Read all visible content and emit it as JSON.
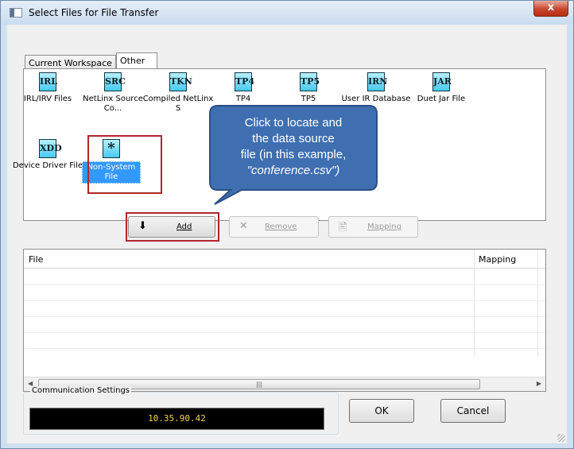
{
  "window": {
    "title": "Select Files for File Transfer",
    "close_glyph": "x"
  },
  "tabs": [
    {
      "label": "Current Workspace"
    },
    {
      "label": "Other"
    }
  ],
  "file_types": [
    {
      "glyph": "IRL",
      "label": "IRL/IRV Files"
    },
    {
      "glyph": "SRC",
      "label": "NetLinx Source Co..."
    },
    {
      "glyph": "TKN",
      "label": "Compiled NetLinx S"
    },
    {
      "glyph": "TP4",
      "label": "TP4"
    },
    {
      "glyph": "TP5",
      "label": "TP5"
    },
    {
      "glyph": "IRN",
      "label": "User IR Database"
    },
    {
      "glyph": "JAR",
      "label": "Duet Jar File"
    },
    {
      "glyph": "XDD",
      "label": "Device Driver File"
    },
    {
      "glyph": "*",
      "label": "Non-System File"
    }
  ],
  "callout": {
    "line1": "Click to locate and",
    "line2": "the data source",
    "line3": "file (in this example,",
    "line4": "\"conference.csv\")"
  },
  "buttons": {
    "add": "Add",
    "remove": "Remove",
    "mapping": "Mapping",
    "ok": "OK",
    "cancel": "Cancel"
  },
  "file_table": {
    "columns": [
      "File",
      "Mapping"
    ],
    "rows": []
  },
  "communication": {
    "group_label": "Communication Settings",
    "ip_address": "10.35.90.42"
  },
  "colors": {
    "highlight": "#3399ff",
    "annotation_red": "#b0262b",
    "callout_blue": "#3f6fb1",
    "ip_text": "#f1d44a"
  }
}
